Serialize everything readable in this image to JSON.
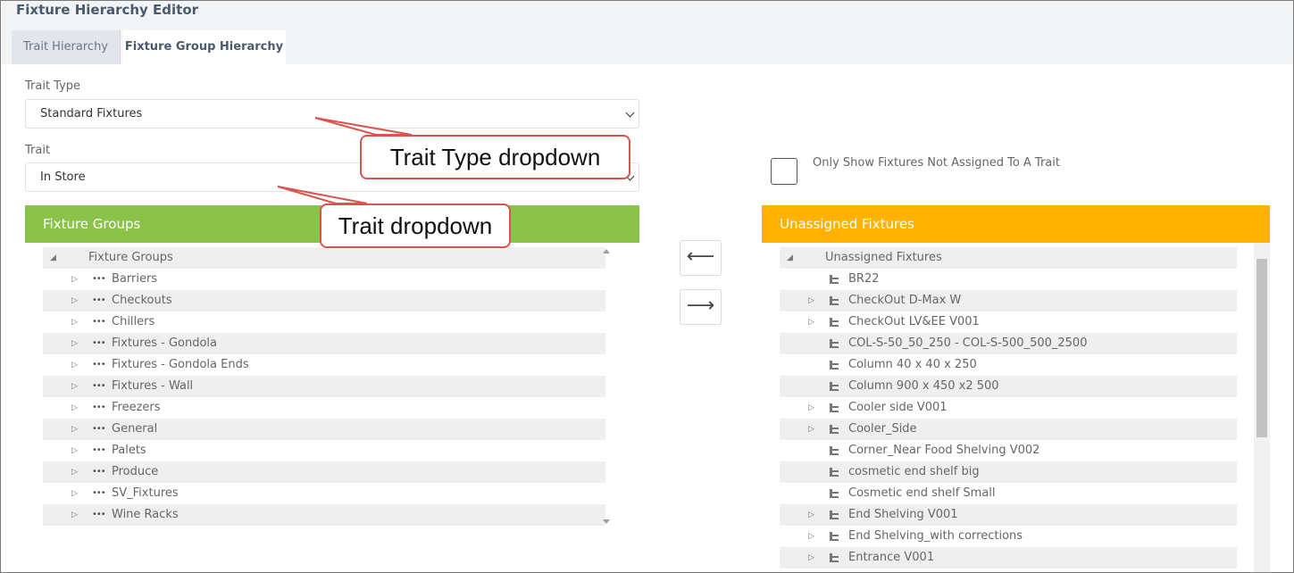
{
  "page": {
    "title": "Fixture Hierarchy Editor"
  },
  "tabs": [
    {
      "label": "Trait Hierarchy",
      "active": false
    },
    {
      "label": "Fixture Group Hierarchy",
      "active": true
    }
  ],
  "trait_type": {
    "label": "Trait Type",
    "value": "Standard Fixtures"
  },
  "trait": {
    "label": "Trait",
    "value": "In Store"
  },
  "filter": {
    "label": "Only Show Fixtures Not Assigned To A Trait",
    "checked": false
  },
  "fixture_groups": {
    "header": "Fixture Groups",
    "root": "Fixture Groups",
    "items": [
      "Barriers",
      "Checkouts",
      "Chillers",
      "Fixtures - Gondola",
      "Fixtures - Gondola Ends",
      "Fixtures - Wall",
      "Freezers",
      "General",
      "Palets",
      "Produce",
      "SV_Fixtures",
      "Wine Racks"
    ]
  },
  "unassigned": {
    "header": "Unassigned Fixtures",
    "root": "Unassigned Fixtures",
    "items": [
      {
        "label": "BR22",
        "expandable": false
      },
      {
        "label": "CheckOut D-Max W",
        "expandable": true
      },
      {
        "label": "CheckOut LV&EE V001",
        "expandable": true
      },
      {
        "label": "COL-S-50_50_250 - COL-S-500_500_2500",
        "expandable": false
      },
      {
        "label": "Column 40 x 40 x 250",
        "expandable": false
      },
      {
        "label": "Column 900 x 450 x2 500",
        "expandable": false
      },
      {
        "label": "Cooler side V001",
        "expandable": true
      },
      {
        "label": "Cooler_Side",
        "expandable": true
      },
      {
        "label": "Corner_Near Food Shelving V002",
        "expandable": false
      },
      {
        "label": "cosmetic end shelf big",
        "expandable": false
      },
      {
        "label": "Cosmetic end shelf Small",
        "expandable": false
      },
      {
        "label": "End Shelving V001",
        "expandable": true
      },
      {
        "label": "End Shelving_with corrections",
        "expandable": true
      },
      {
        "label": "Entrance V001",
        "expandable": true
      }
    ]
  },
  "buttons": {
    "move_left": "⟵",
    "move_right": "⟶"
  },
  "annotations": {
    "trait_type_callout": "Trait Type dropdown",
    "trait_callout": "Trait dropdown"
  },
  "colors": {
    "fixture_groups_header": "#8bc34a",
    "unassigned_header": "#ffb300",
    "callout_border": "#d9534f"
  }
}
